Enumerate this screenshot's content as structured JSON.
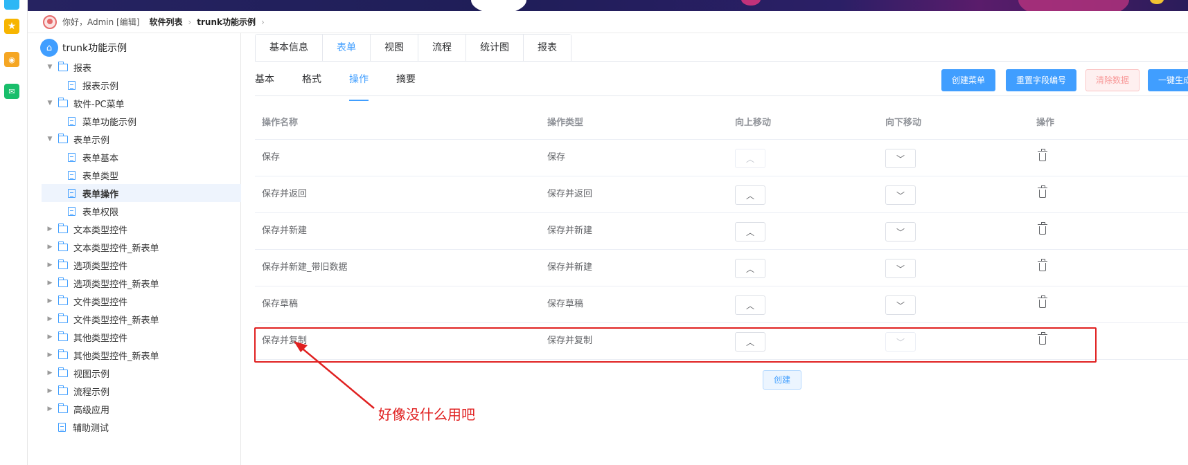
{
  "header": {
    "greeting": "你好，Admin [编辑]",
    "breadcrumb": [
      "软件列表",
      "trunk功能示例"
    ]
  },
  "tree": {
    "root": "trunk功能示例",
    "nodes": [
      {
        "label": "报表",
        "type": "folder",
        "expanded": true
      },
      {
        "label": "报表示例",
        "type": "doc"
      },
      {
        "label": "软件-PC菜单",
        "type": "folder",
        "expanded": true
      },
      {
        "label": "菜单功能示例",
        "type": "doc"
      },
      {
        "label": "表单示例",
        "type": "folder",
        "expanded": true
      },
      {
        "label": "表单基本",
        "type": "doc"
      },
      {
        "label": "表单类型",
        "type": "doc"
      },
      {
        "label": "表单操作",
        "type": "doc",
        "active": true
      },
      {
        "label": "表单权限",
        "type": "doc"
      },
      {
        "label": "文本类型控件",
        "type": "folder"
      },
      {
        "label": "文本类型控件_新表单",
        "type": "folder"
      },
      {
        "label": "选项类型控件",
        "type": "folder"
      },
      {
        "label": "选项类型控件_新表单",
        "type": "folder"
      },
      {
        "label": "文件类型控件",
        "type": "folder"
      },
      {
        "label": "文件类型控件_新表单",
        "type": "folder"
      },
      {
        "label": "其他类型控件",
        "type": "folder"
      },
      {
        "label": "其他类型控件_新表单",
        "type": "folder"
      },
      {
        "label": "视图示例",
        "type": "folder"
      },
      {
        "label": "流程示例",
        "type": "folder"
      },
      {
        "label": "高级应用",
        "type": "folder"
      },
      {
        "label": "辅助测试",
        "type": "doc"
      }
    ]
  },
  "tabs": [
    "基本信息",
    "表单",
    "视图",
    "流程",
    "统计图",
    "报表"
  ],
  "subtabs": [
    "基本",
    "格式",
    "操作",
    "摘要"
  ],
  "buttons": {
    "create_menu": "创建菜单",
    "reset_field_no": "重置字段编号",
    "clear_data": "清除数据",
    "one_click": "一键生成"
  },
  "table": {
    "headers": [
      "操作名称",
      "操作类型",
      "向上移动",
      "向下移动",
      "操作"
    ],
    "rows": [
      {
        "name": "保存",
        "type": "保存"
      },
      {
        "name": "保存并返回",
        "type": "保存并返回"
      },
      {
        "name": "保存并新建",
        "type": "保存并新建"
      },
      {
        "name": "保存并新建_带旧数据",
        "type": "保存并新建"
      },
      {
        "name": "保存草稿",
        "type": "保存草稿"
      },
      {
        "name": "保存并复制",
        "type": "保存并复制"
      }
    ],
    "create_label": "创建"
  },
  "annotation": "好像没什么用吧"
}
